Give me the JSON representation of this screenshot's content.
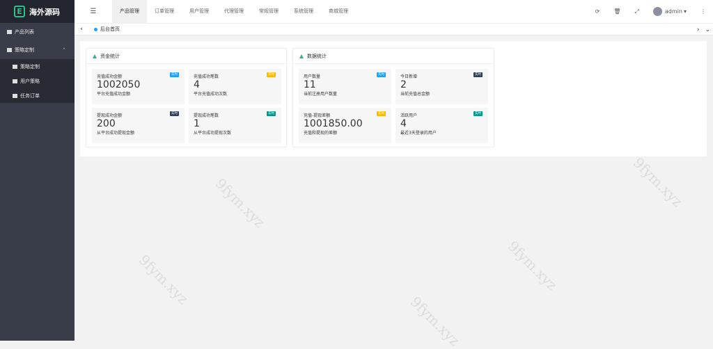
{
  "brand": {
    "logo_letter": "E",
    "name": "海外源码"
  },
  "sidebar": {
    "items": [
      {
        "label": "产品列表"
      },
      {
        "label": "策略定制"
      }
    ],
    "sub_items": [
      {
        "label": "策略定制"
      },
      {
        "label": "用户策略"
      },
      {
        "label": "任务订单"
      }
    ]
  },
  "topnav": {
    "tabs": [
      "产品管理",
      "订单管理",
      "用户管理",
      "代理管理",
      "常规管理",
      "系统管理",
      "商城管理"
    ],
    "user": "admin",
    "menu_icon": "☰",
    "refresh_icon": "⟳",
    "delete_icon": "🗑",
    "fullscreen_icon": "⤢",
    "more_icon": "⋮",
    "dropdown_icon": "▾"
  },
  "tabsbar": {
    "current": "后台首页",
    "prev": "‹",
    "next": "›",
    "down": "⌄"
  },
  "funds": {
    "title": "资金统计",
    "stats": [
      {
        "title": "充值成功金额",
        "value": "1002050",
        "desc": "平台充值成功金额",
        "badge": "实时",
        "color": "#1e9fff"
      },
      {
        "title": "充值成功笔数",
        "value": "4",
        "desc": "平台充值成功次数",
        "badge": "实时",
        "color": "#ffb800"
      },
      {
        "title": "提现成功金额",
        "value": "200",
        "desc": "从平台成功提现金额",
        "badge": "实时",
        "color": "#2f4056"
      },
      {
        "title": "提现成功笔数",
        "value": "1",
        "desc": "从平台成功提现次数",
        "badge": "实时",
        "color": "#009688"
      }
    ]
  },
  "data": {
    "title": "数据统计",
    "stats": [
      {
        "title": "用户数量",
        "value": "11",
        "desc": "当前注册用户数量",
        "badge": "实时",
        "color": "#1e9fff"
      },
      {
        "title": "今日新增",
        "value": "2",
        "desc": "当前充值总金额",
        "badge": "实时",
        "color": "#2f4056"
      },
      {
        "title": "充值-提现差额",
        "value": "1001850.00",
        "desc": "充值和提现的差额",
        "badge": "实时",
        "color": "#ffb800"
      },
      {
        "title": "活跃用户",
        "value": "4",
        "desc": "最近3天登录的用户",
        "badge": "实时",
        "color": "#009688"
      }
    ]
  },
  "watermark": "9fym.xyz"
}
